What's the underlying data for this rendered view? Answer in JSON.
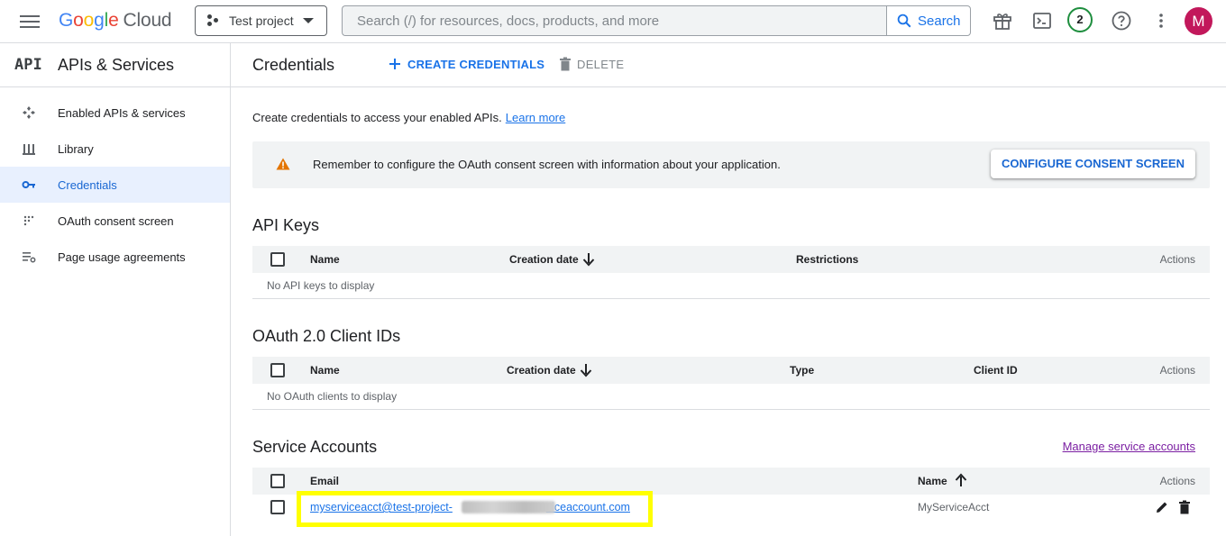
{
  "topbar": {
    "logo_letters": [
      "G",
      "o",
      "o",
      "g",
      "l",
      "e"
    ],
    "logo_suffix": "Cloud",
    "project_label": "Test project",
    "search_placeholder": "Search (/) for resources, docs, products, and more",
    "search_button": "Search",
    "notification_count": "2",
    "avatar_initial": "M"
  },
  "sidebar": {
    "api_mark": "API",
    "title": "APIs & Services",
    "items": [
      {
        "label": "Enabled APIs & services",
        "icon": "enabled-apis-icon"
      },
      {
        "label": "Library",
        "icon": "library-icon"
      },
      {
        "label": "Credentials",
        "icon": "key-icon",
        "active": true
      },
      {
        "label": "OAuth consent screen",
        "icon": "oauth-consent-icon"
      },
      {
        "label": "Page usage agreements",
        "icon": "page-usage-icon"
      }
    ]
  },
  "main": {
    "title": "Credentials",
    "create_label": "CREATE CREDENTIALS",
    "delete_label": "DELETE",
    "intro_text": "Create credentials to access your enabled APIs.",
    "learn_more": "Learn more",
    "banner": {
      "message": "Remember to configure the OAuth consent screen with information about your application.",
      "button": "CONFIGURE CONSENT SCREEN",
      "warning_color": "#e37400"
    },
    "api_keys": {
      "title": "API Keys",
      "columns": [
        "Name",
        "Creation date",
        "Restrictions",
        "Actions"
      ],
      "empty": "No API keys to display"
    },
    "oauth": {
      "title": "OAuth 2.0 Client IDs",
      "columns": [
        "Name",
        "Creation date",
        "Type",
        "Client ID",
        "Actions"
      ],
      "empty": "No OAuth clients to display"
    },
    "service_accounts": {
      "title": "Service Accounts",
      "manage_link": "Manage service accounts",
      "columns": [
        "Email",
        "Name",
        "Actions"
      ],
      "rows": [
        {
          "email_visible_start": "myserviceacct@test-project-",
          "email_visible_end": "viceaccount.com",
          "name": "MyServiceAcct"
        }
      ]
    }
  },
  "colors": {
    "accent": "#1a73e8",
    "highlight": "#ffff00",
    "active_bg": "#e8f0fe",
    "avatar_bg": "#c2185b"
  }
}
